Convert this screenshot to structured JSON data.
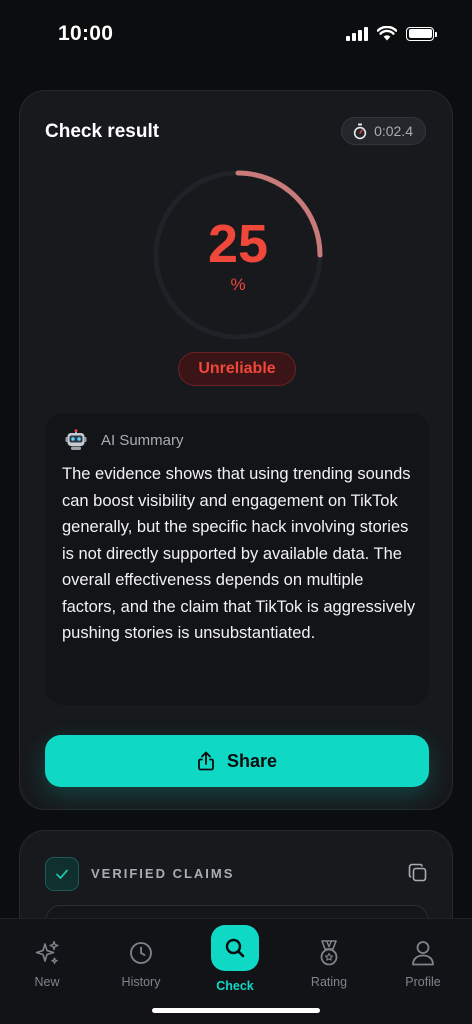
{
  "status_bar": {
    "time": "10:00"
  },
  "result": {
    "title": "Check result",
    "timer": "0:02.4",
    "score": "25",
    "score_fraction": 0.25,
    "unit": "%",
    "verdict": "Unreliable",
    "summary_title": "AI Summary",
    "summary_text": "The evidence shows that using trending sounds can boost visibility and engagement on TikTok generally, but the specific hack involving stories is not directly supported by available data. The overall effectiveness depends on multiple factors, and the claim that TikTok is aggressively pushing stories is unsubstantiated.",
    "share_label": "Share"
  },
  "claims": {
    "title": "VERIFIED CLAIMS"
  },
  "nav": {
    "items": [
      {
        "label": "New",
        "icon": "sparkles-icon"
      },
      {
        "label": "History",
        "icon": "clock-icon"
      },
      {
        "label": "Check",
        "icon": "search-icon"
      },
      {
        "label": "Rating",
        "icon": "medal-icon"
      },
      {
        "label": "Profile",
        "icon": "user-icon"
      }
    ],
    "active": "Check"
  },
  "colors": {
    "accent": "#0fd9c5",
    "danger": "#f0473b",
    "background": "#0c0d0f",
    "card": "#17191c"
  }
}
